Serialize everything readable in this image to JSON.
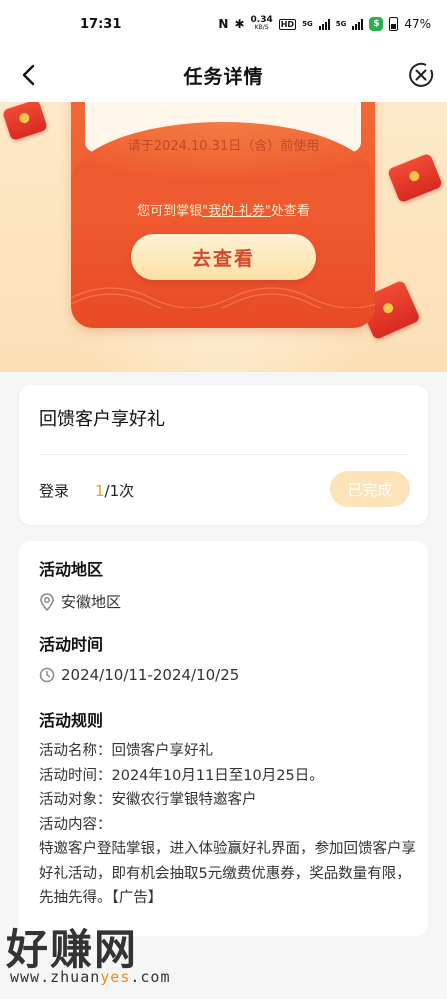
{
  "status_bar": {
    "time": "17:31",
    "speed": "0.34",
    "speed_unit": "KB/S",
    "hd": "HD",
    "net1": "5G",
    "net2": "5G",
    "battery": "47%"
  },
  "nav": {
    "title": "任务详情"
  },
  "banner": {
    "expiry_note": "请于2024.10.31日（含）前使用",
    "tip_prefix": "您可到掌银",
    "tip_link": "\"我的-礼券\"",
    "tip_suffix": "处查看",
    "cta_label": "去查看"
  },
  "task": {
    "name": "回馈客户享好礼",
    "label": "登录",
    "done_count": "1",
    "total": "/1次",
    "status_button": "已完成"
  },
  "info": {
    "region_title": "活动地区",
    "region_value": "安徽地区",
    "time_title": "活动时间",
    "time_value": "2024/10/11-2024/10/25",
    "rules_title": "活动规则",
    "rules": [
      "活动名称：回馈客户享好礼",
      "活动时间：2024年10月11日至10月25日。",
      "活动对象：安徽农行掌银特邀客户",
      "活动内容：",
      "特邀客户登陆掌银，进入体验赢好礼界面，参加回馈客户享好礼活动，即有机会抽取5元缴费优惠券，奖品数量有限，先抽先得。【广告】"
    ]
  },
  "watermark": {
    "brand": "好赚网",
    "url_prefix": "www.zhuan",
    "url_highlight": "yes",
    "url_suffix": ".com"
  },
  "colors": {
    "accent_orange": "#f0a020",
    "banner_red": "#ee5a2f",
    "done_button": "#fde3b8"
  }
}
